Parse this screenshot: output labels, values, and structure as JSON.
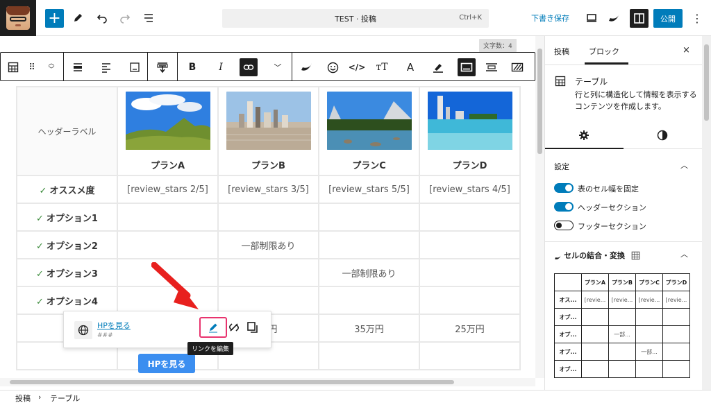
{
  "topbar": {
    "doc_title": "TEST · 投稿",
    "shortcut": "Ctrl+K",
    "draft_label": "下書き保存",
    "publish_label": "公開"
  },
  "editor": {
    "word_count": "文字数：4",
    "table": {
      "header_label": "ヘッダーラベル",
      "plans": [
        "プランA",
        "プランB",
        "プランC",
        "プランD"
      ],
      "rows": [
        {
          "label": "オススメ度",
          "cells": [
            "[review_stars 2/5]",
            "[review_stars 3/5]",
            "[review_stars 5/5]",
            "[review_stars 4/5]"
          ]
        },
        {
          "label": "オプション1",
          "cells": [
            "",
            "",
            "",
            ""
          ]
        },
        {
          "label": "オプション2",
          "cells": [
            "",
            "一部制限あり",
            "",
            ""
          ]
        },
        {
          "label": "オプション3",
          "cells": [
            "",
            "",
            "一部制限あり",
            ""
          ]
        },
        {
          "label": "オプション4",
          "cells": [
            "",
            "",
            "",
            ""
          ]
        },
        {
          "label": "",
          "cells": [
            "",
            "万円",
            "35万円",
            "25万円"
          ]
        }
      ]
    },
    "link_popover": {
      "link_text": "HPを見る",
      "url": "###",
      "tooltip": "リンクを編集"
    },
    "hp_button_label": "HPを見る"
  },
  "breadcrumb": {
    "items": [
      "投稿",
      "テーブル"
    ],
    "separator": "›"
  },
  "sidebar": {
    "tabs": [
      "投稿",
      "ブロック"
    ],
    "close_label": "×",
    "block_title": "テーブル",
    "block_desc": "行と列に構造化して情報を表示するコンテンツを作成します。",
    "settings_title": "設定",
    "toggles": [
      {
        "label": "表のセル幅を固定",
        "on": true
      },
      {
        "label": "ヘッダーセクション",
        "on": true
      },
      {
        "label": "フッターセクション",
        "on": false
      }
    ],
    "merge_title": "セルの結合・変換",
    "merge_table": {
      "header": [
        "",
        "プランA",
        "プランB",
        "プランC",
        "プランD"
      ],
      "rows": [
        [
          "オス...",
          "[revie...",
          "[revie...",
          "[revie...",
          "[revie..."
        ],
        [
          "オプ...",
          "",
          "",
          "",
          ""
        ],
        [
          "オプ...",
          "",
          "一部...",
          "",
          ""
        ],
        [
          "オプ...",
          "",
          "",
          "一部...",
          ""
        ],
        [
          "オプ...",
          "",
          "",
          "",
          ""
        ]
      ]
    }
  },
  "colors": {
    "accent": "#007cba",
    "highlight": "#e8336e",
    "arrow": "#e8201e",
    "check": "#3a8a3a"
  }
}
